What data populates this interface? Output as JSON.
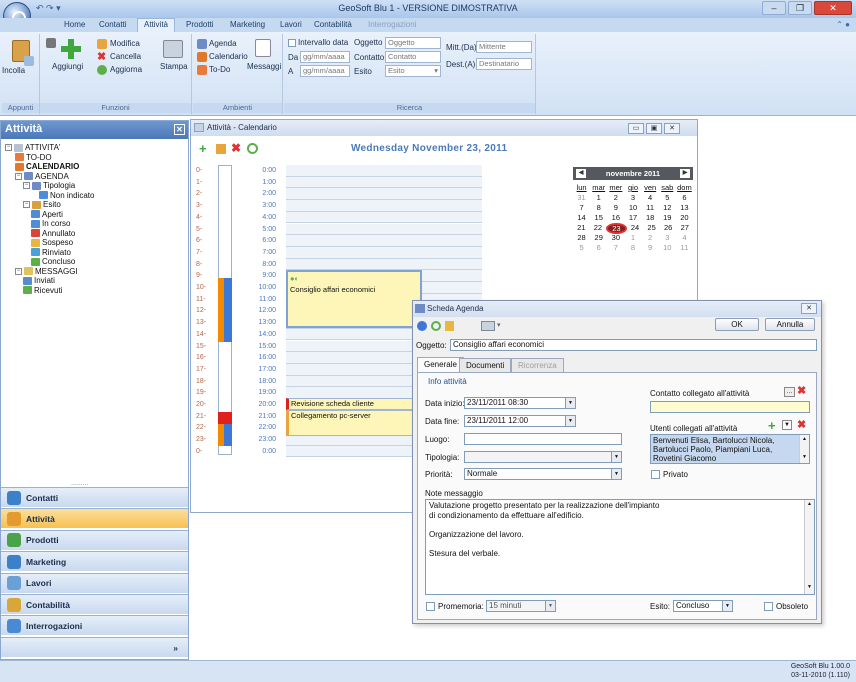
{
  "window": {
    "title": "GeoSoft Blu 1 - VERSIONE DIMOSTRATIVA"
  },
  "ribbon": {
    "tabs": [
      "Home",
      "Contatti",
      "Attività",
      "Prodotti",
      "Marketing",
      "Lavori",
      "Contabilità",
      "Interrogazioni"
    ],
    "active_tab": "Attività",
    "groups": {
      "appunti": {
        "label": "Appunti",
        "incolla": "Incolla"
      },
      "funzioni": {
        "label": "Funzioni",
        "aggiungi": "Aggiungi",
        "modifica": "Modifica",
        "cancella": "Cancella",
        "aggiorna": "Aggiorna",
        "stampa": "Stampa"
      },
      "ambienti": {
        "label": "Ambienti",
        "agenda": "Agenda",
        "calendario": "Calendario",
        "todo": "To-Do",
        "messaggi": "Messaggi"
      },
      "ricerca": {
        "label": "Ricerca",
        "intervallo": "Intervallo data",
        "da": "Da",
        "a": "A",
        "date_placeholder": "gg/mm/aaaa",
        "oggetto": "Oggetto",
        "oggetto_value": "Oggetto",
        "contatto": "Contatto",
        "contatto_value": "Contatto",
        "esito": "Esito",
        "esito_value": "Esito",
        "mitt": "Mitt.(Da)",
        "mitt_value": "Mittente",
        "dest": "Dest.(A)",
        "dest_value": "Destinatario"
      }
    }
  },
  "leftpanel": {
    "title": "Attività",
    "tree": [
      {
        "label": "ATTIVITA'",
        "level": 0,
        "color": "#b6c2cf"
      },
      {
        "label": "TO-DO",
        "level": 1,
        "color": "#e87a3b"
      },
      {
        "label": "CALENDARIO",
        "level": 1,
        "color": "#e07a2a",
        "bold": true
      },
      {
        "label": "AGENDA",
        "level": 1,
        "color": "#6f8bc7"
      },
      {
        "label": "Tipologia",
        "level": 2,
        "color": "#6f8bc7"
      },
      {
        "label": "Non indicato",
        "level": 4,
        "color": "#4f8bd6"
      },
      {
        "label": "Esito",
        "level": 2,
        "color": "#d9a040"
      },
      {
        "label": "Aperti",
        "level": 3,
        "color": "#4f8bd6"
      },
      {
        "label": "In corso",
        "level": 3,
        "color": "#4f8bd6"
      },
      {
        "label": "Annullato",
        "level": 3,
        "color": "#d9443b"
      },
      {
        "label": "Sospeso",
        "level": 3,
        "color": "#e9b640"
      },
      {
        "label": "Rinviato",
        "level": 3,
        "color": "#4aa0d8"
      },
      {
        "label": "Concluso",
        "level": 3,
        "color": "#5cb047"
      },
      {
        "label": "MESSAGGI",
        "level": 1,
        "color": "#e2c25a"
      },
      {
        "label": "Inviati",
        "level": 2,
        "color": "#5a8ccc"
      },
      {
        "label": "Ricevuti",
        "level": 2,
        "color": "#5cb047"
      }
    ],
    "nav": [
      {
        "label": "Contatti",
        "color": "#3c80c9"
      },
      {
        "label": "Attività",
        "color": "#e39a2e",
        "active": true
      },
      {
        "label": "Prodotti",
        "color": "#4aa34a"
      },
      {
        "label": "Marketing",
        "color": "#3c80c9"
      },
      {
        "label": "Lavori",
        "color": "#6aa0d8"
      },
      {
        "label": "Contabilità",
        "color": "#d9a63a"
      },
      {
        "label": "Interrogazioni",
        "color": "#4a8ad4"
      }
    ],
    "overflow": "»",
    "grip": "........."
  },
  "calendar": {
    "window_title": "Attività - Calendario",
    "date_heading": "Wednesday November 23, 2011",
    "hours": [
      {
        "l": "0-",
        "t": "0:00"
      },
      {
        "l": "1-",
        "t": "1:00"
      },
      {
        "l": "2-",
        "t": "2:00"
      },
      {
        "l": "3-",
        "t": "3:00"
      },
      {
        "l": "4-",
        "t": "4:00"
      },
      {
        "l": "5-",
        "t": "5:00"
      },
      {
        "l": "6-",
        "t": "6:00"
      },
      {
        "l": "7-",
        "t": "7:00"
      },
      {
        "l": "8-",
        "t": "8:00"
      },
      {
        "l": "9-",
        "t": "9:00"
      },
      {
        "l": "10-",
        "t": "10:00"
      },
      {
        "l": "11-",
        "t": "11:00"
      },
      {
        "l": "12-",
        "t": "12:00"
      },
      {
        "l": "13-",
        "t": "13:00"
      },
      {
        "l": "14-",
        "t": "14:00"
      },
      {
        "l": "15-",
        "t": "15:00"
      },
      {
        "l": "16-",
        "t": "16:00"
      },
      {
        "l": "17-",
        "t": "17:00"
      },
      {
        "l": "18-",
        "t": "18:00"
      },
      {
        "l": "19-",
        "t": "19:00"
      },
      {
        "l": "20-",
        "t": "20:00"
      },
      {
        "l": "21-",
        "t": "21:00"
      },
      {
        "l": "22-",
        "t": "22:00"
      },
      {
        "l": "23-",
        "t": "23:00"
      },
      {
        "l": "0-",
        "t": "0:00"
      }
    ],
    "events": [
      {
        "title": "Consiglio affari economici"
      },
      {
        "title": "Revisione scheda cliente"
      },
      {
        "title": "Collegamento pc-server"
      }
    ],
    "minical": {
      "month": "novembre 2011",
      "days": [
        "lun",
        "mar",
        "mer",
        "gio",
        "ven",
        "sab",
        "dom"
      ],
      "weeks": [
        [
          "31",
          "1",
          "2",
          "3",
          "4",
          "5",
          "6"
        ],
        [
          "7",
          "8",
          "9",
          "10",
          "11",
          "12",
          "13"
        ],
        [
          "14",
          "15",
          "16",
          "17",
          "18",
          "19",
          "20"
        ],
        [
          "21",
          "22",
          "23",
          "24",
          "25",
          "26",
          "27"
        ],
        [
          "28",
          "29",
          "30",
          "1",
          "2",
          "3",
          "4"
        ],
        [
          "5",
          "6",
          "7",
          "8",
          "9",
          "10",
          "11"
        ]
      ],
      "selected": "23"
    }
  },
  "dialog": {
    "title": "Scheda Agenda",
    "ok": "OK",
    "annulla": "Annulla",
    "oggetto_label": "Oggetto:",
    "oggetto_value": "Consiglio affari economici",
    "tabs": [
      "Generale",
      "Documenti",
      "Ricorrenza"
    ],
    "info_label": "Info attività",
    "data_inizio_label": "Data inizio:",
    "data_inizio": "23/11/2011 08:30",
    "data_fine_label": "Data fine:",
    "data_fine": "23/11/2011 12:00",
    "luogo_label": "Luogo:",
    "luogo": "",
    "tipologia_label": "Tipologia:",
    "tipologia": "",
    "priorita_label": "Priorità:",
    "priorita": "Normale",
    "contatto_label": "Contatto collegato all'attività",
    "utenti_label": "Utenti collegati all'attività",
    "utenti": "Benvenuti Elisa, Bartolucci Nicola, Bartolucci Paolo, Piampiani Luca, Rovetini Giacomo",
    "privato": "Privato",
    "note_label": "Note messaggio",
    "note_lines": [
      "Valutazione progetto presentato per la realizzazione dell'impianto",
      "di condizionamento da effettuare all'edificio.",
      "",
      "Organizzazione del lavoro.",
      "",
      "Stesura del verbale."
    ],
    "promemoria_label": "Promemoria:",
    "promemoria": "15 minuti",
    "esito_label": "Esito:",
    "esito": "Concluso",
    "obsoleto": "Obsoleto"
  },
  "status": {
    "line1": "GeoSoft Blu 1.00.0",
    "line2": "03-11-2010 (1.110)"
  }
}
